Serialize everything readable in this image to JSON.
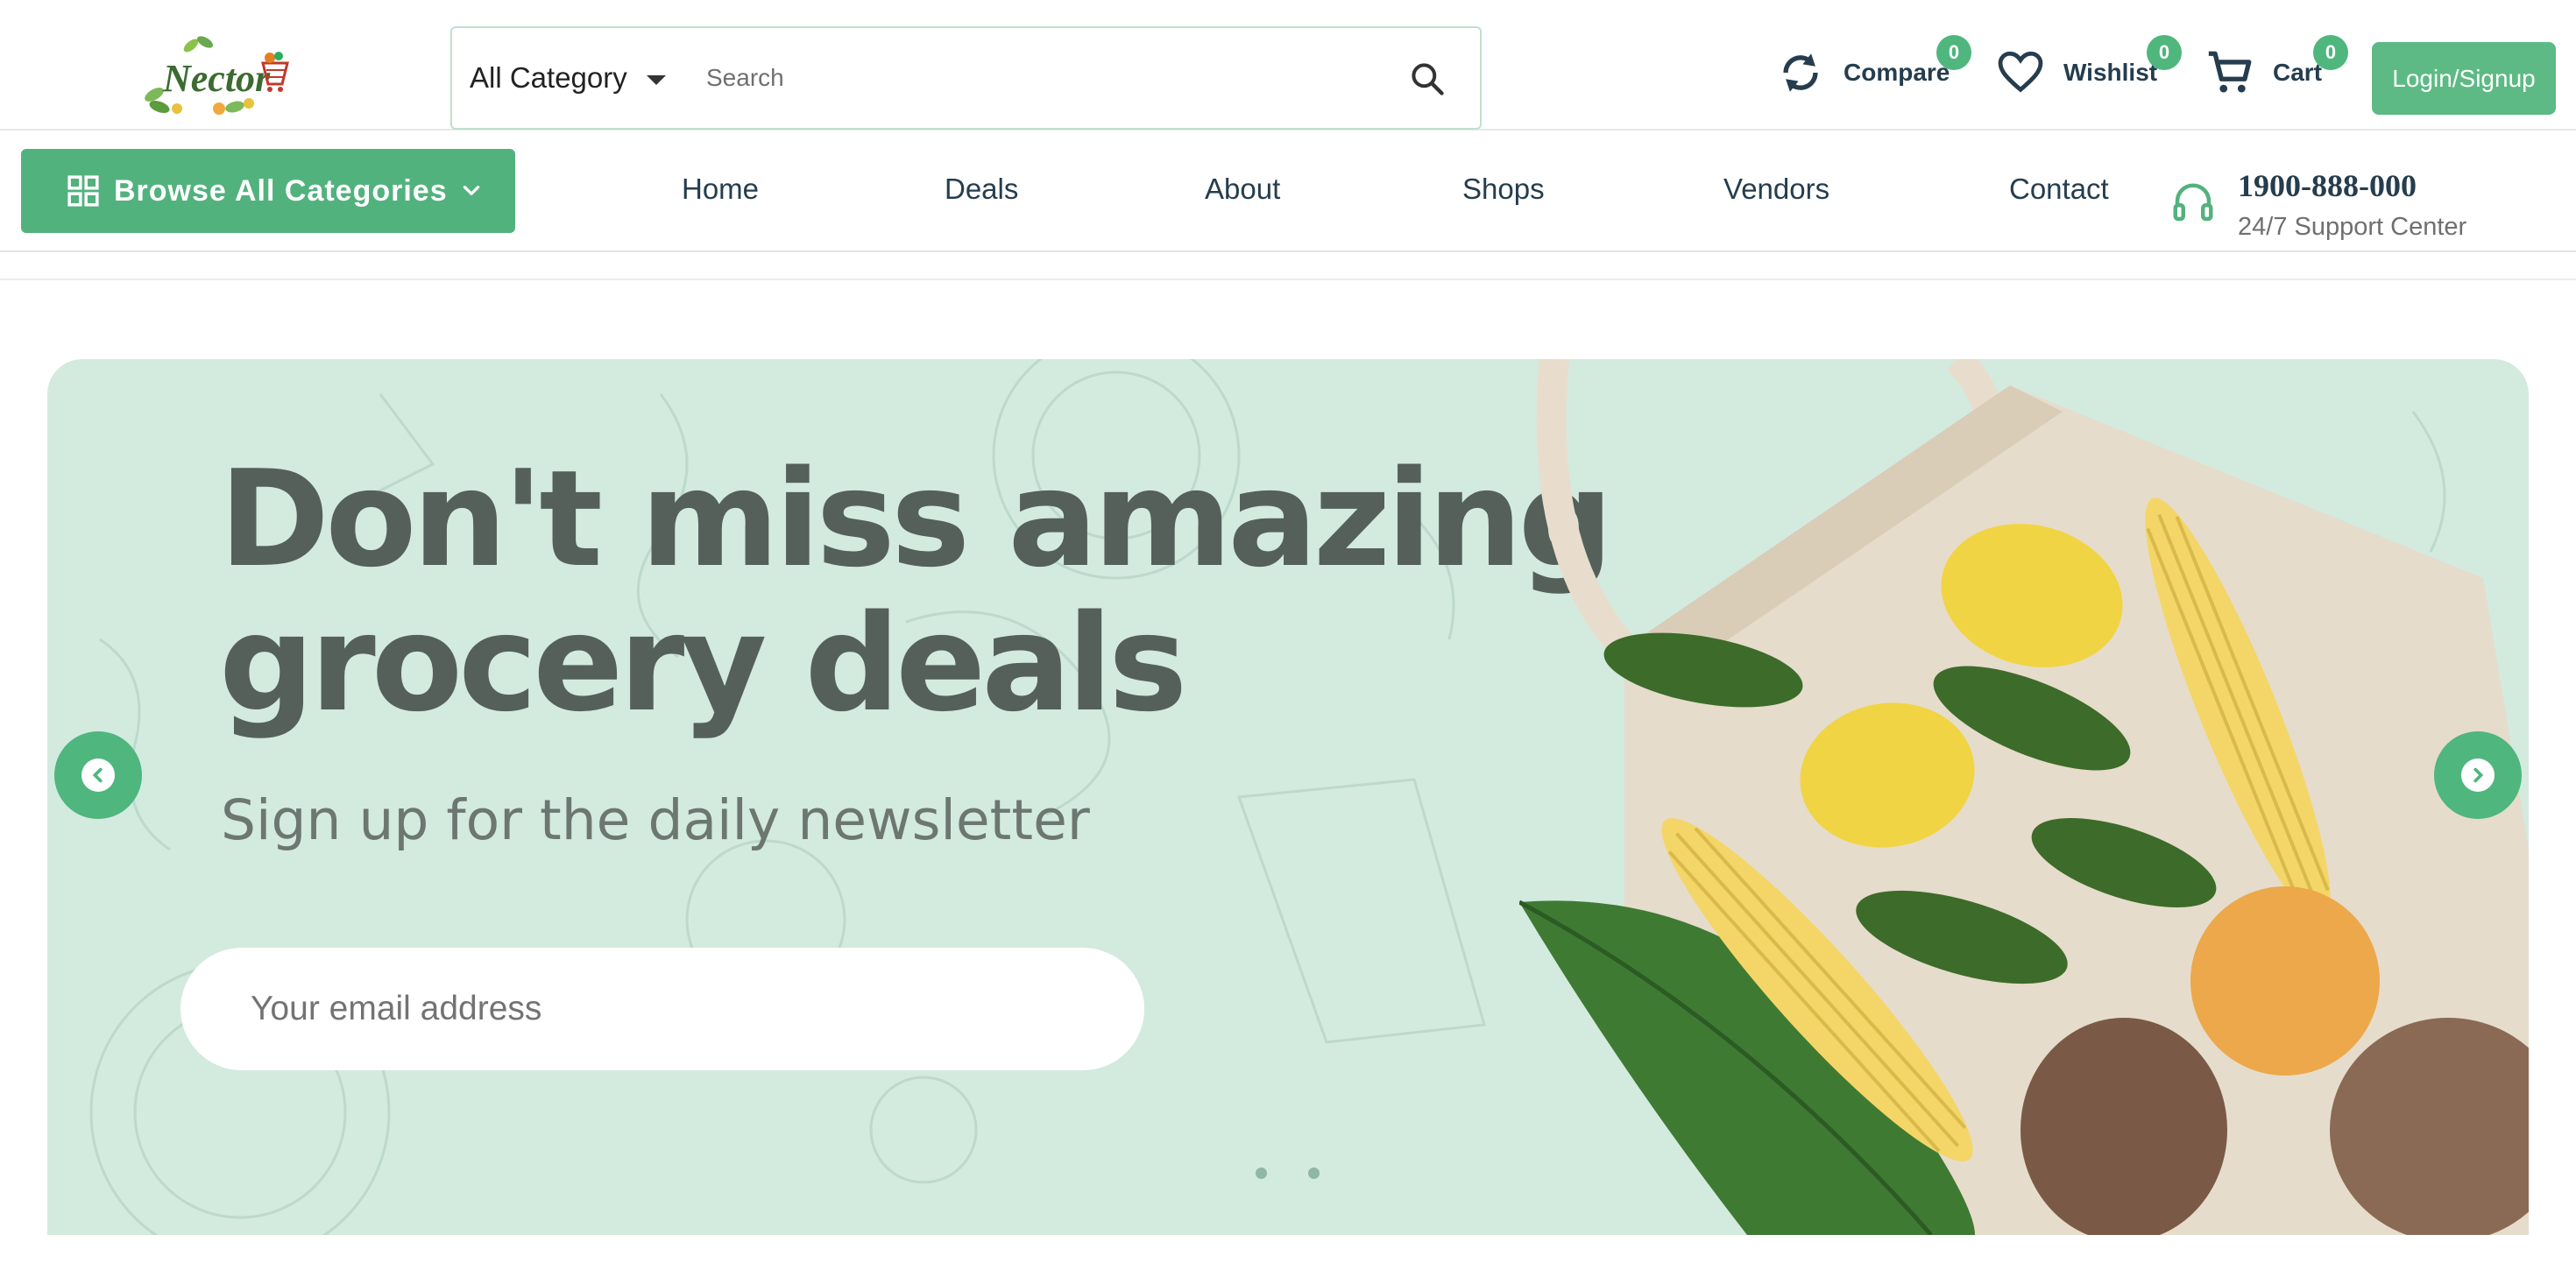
{
  "header": {
    "logo_text": "Nector",
    "category_select": "All Category",
    "search_placeholder": "Search",
    "compare": {
      "label": "Compare",
      "count": "0",
      "icon": "compare-icon"
    },
    "wishlist": {
      "label": "Wishlist",
      "count": "0",
      "icon": "heart-icon"
    },
    "cart": {
      "label": "Cart",
      "count": "0",
      "icon": "cart-icon"
    },
    "login_label": "Login/Signup"
  },
  "nav": {
    "browse_label": "Browse All Categories",
    "links": [
      "Home",
      "Deals",
      "About",
      "Shops",
      "Vendors",
      "Contact"
    ],
    "support_phone": "1900-888-000",
    "support_label": "24/7 Support Center"
  },
  "hero": {
    "title_line1": "Don't miss amazing",
    "title_line2": "grocery deals",
    "subtitle": "Sign up for the daily newsletter",
    "email_placeholder": "Your email address",
    "slide_count": 2,
    "active_slide": 1
  },
  "colors": {
    "accent": "#4fb67e",
    "hero_bg": "#d3eadf",
    "heading": "#55605b",
    "text": "#253d4e"
  }
}
